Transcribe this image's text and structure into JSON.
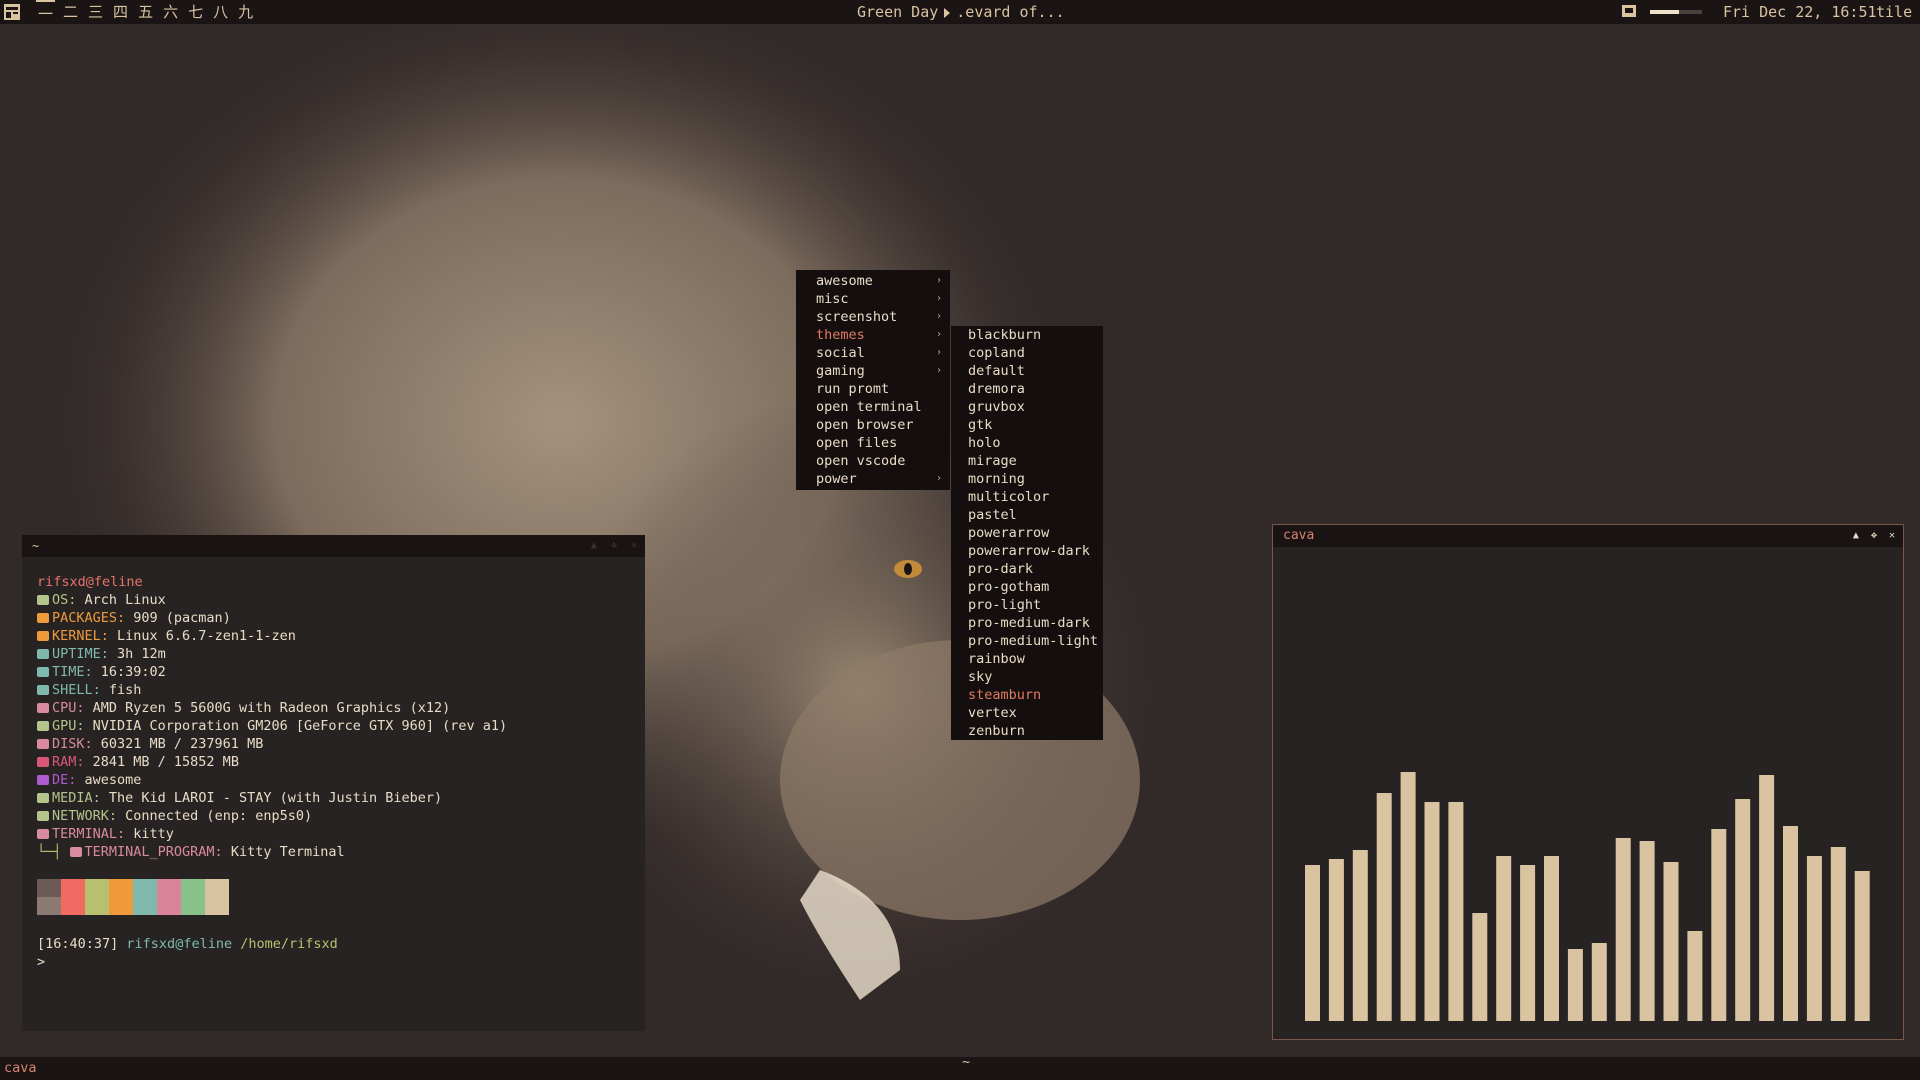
{
  "topbar": {
    "layout_icon": "layout-grid-icon",
    "tags": [
      "一",
      "二",
      "三",
      "四",
      "五",
      "六",
      "七",
      "八",
      "九"
    ],
    "active_tag": 0,
    "media": {
      "artist": "Green Day",
      "track": ".evard of..."
    },
    "volume_icon": "speaker-icon",
    "volume_level": 0.55,
    "clock": "Fri Dec 22, 16:51",
    "layout": "tile"
  },
  "menu": {
    "items": [
      {
        "label": "awesome",
        "submenu": true
      },
      {
        "label": "misc",
        "submenu": true
      },
      {
        "label": "screenshot",
        "submenu": true
      },
      {
        "label": "themes",
        "submenu": true
      },
      {
        "label": "social",
        "submenu": true
      },
      {
        "label": "gaming",
        "submenu": true
      },
      {
        "label": "run promt",
        "submenu": false
      },
      {
        "label": "open terminal",
        "submenu": false
      },
      {
        "label": "open browser",
        "submenu": false
      },
      {
        "label": "open files",
        "submenu": false
      },
      {
        "label": "open vscode",
        "submenu": false
      },
      {
        "label": "power",
        "submenu": true
      }
    ],
    "active_item": "themes",
    "submenu_items": [
      "blackburn",
      "copland",
      "default",
      "dremora",
      "gruvbox",
      "gtk",
      "holo",
      "mirage",
      "morning",
      "multicolor",
      "pastel",
      "powerarrow",
      "powerarrow-dark",
      "pro-dark",
      "pro-gotham",
      "pro-light",
      "pro-medium-dark",
      "pro-medium-light",
      "rainbow",
      "sky",
      "steamburn",
      "vertex",
      "zenburn"
    ],
    "submenu_active": "steamburn"
  },
  "terminal": {
    "title": "~",
    "userhost": "rifsxd@feline",
    "info": [
      {
        "key": "OS:",
        "value": " Arch Linux",
        "color": "#b4c48a",
        "icon": "monitor-icon"
      },
      {
        "key": "PACKAGES:",
        "value": " 909 (pacman)",
        "color": "#ef9a3c",
        "icon": "package-icon"
      },
      {
        "key": "KERNEL:",
        "value": " Linux 6.6.7-zen1-1-zen",
        "color": "#ef9a3c",
        "icon": "penguin-icon"
      },
      {
        "key": "UPTIME:",
        "value": " 3h 12m",
        "color": "#7fb9ae",
        "icon": "uptime-icon"
      },
      {
        "key": "TIME:",
        "value": " 16:39:02",
        "color": "#7fb9ae",
        "icon": "clock-icon"
      },
      {
        "key": "SHELL:",
        "value": " fish",
        "color": "#7fb9ae",
        "icon": "shell-icon"
      },
      {
        "key": "CPU:",
        "value": " AMD Ryzen 5 5600G with Radeon Graphics (x12)",
        "color": "#d98aa0",
        "icon": "cpu-icon"
      },
      {
        "key": "GPU:",
        "value": " NVIDIA Corporation GM206 [GeForce GTX 960] (rev a1)",
        "color": "#b4c48a",
        "icon": "gpu-icon"
      },
      {
        "key": "DISK:",
        "value": " 60321 MB / 237961 MB",
        "color": "#d98aa0",
        "icon": "disk-icon"
      },
      {
        "key": "RAM:",
        "value": " 2841 MB / 15852 MB",
        "color": "#d9587a",
        "icon": "ram-icon"
      },
      {
        "key": "DE:",
        "value": " awesome",
        "color": "#b05ad0",
        "icon": "desktop-icon"
      },
      {
        "key": "MEDIA:",
        "value": " The Kid LAROI - STAY (with Justin Bieber)",
        "color": "#b4c48a",
        "icon": "music-icon"
      },
      {
        "key": "NETWORK:",
        "value": " Connected (enp: enp5s0)",
        "color": "#b4c48a",
        "icon": "network-icon"
      },
      {
        "key": "TERMINAL:",
        "value": " kitty",
        "color": "#d98aa0",
        "icon": "terminal-icon"
      }
    ],
    "subinfo": {
      "prefix": "└─┤ ",
      "key": "TERMINAL_PROGRAM:",
      "value": " Kitty Terminal",
      "color": "#d98aa0",
      "icon": "terminal-icon"
    },
    "swatches_top": [
      "#6b5a55",
      "#ef6a60",
      "#b8c070",
      "#ef9a3c",
      "#7fb9ae",
      "#d9849a",
      "#8ac08a",
      "#d9c3a0"
    ],
    "swatches_bottom": [
      "#8a7a72",
      "#ef6a60",
      "#b8c070",
      "#ef9a3c",
      "#7fb9ae",
      "#d9849a",
      "#8ac08a",
      "#d9c3a0"
    ],
    "prompt_time": "[16:40:37]",
    "prompt_user": "rifsxd@feline",
    "prompt_path": "/home/rifsxd",
    "prompt_symbol": ">"
  },
  "cava": {
    "title": "cava",
    "bar_color": "#d9c3a0",
    "levels": [
      0.52,
      0.54,
      0.57,
      0.76,
      0.83,
      0.73,
      0.73,
      0.36,
      0.55,
      0.52,
      0.55,
      0.24,
      0.26,
      0.61,
      0.6,
      0.53,
      0.3,
      0.64,
      0.74,
      0.82,
      0.65,
      0.55,
      0.58,
      0.5
    ]
  },
  "bottombar": {
    "task": "cava",
    "center": "~"
  }
}
